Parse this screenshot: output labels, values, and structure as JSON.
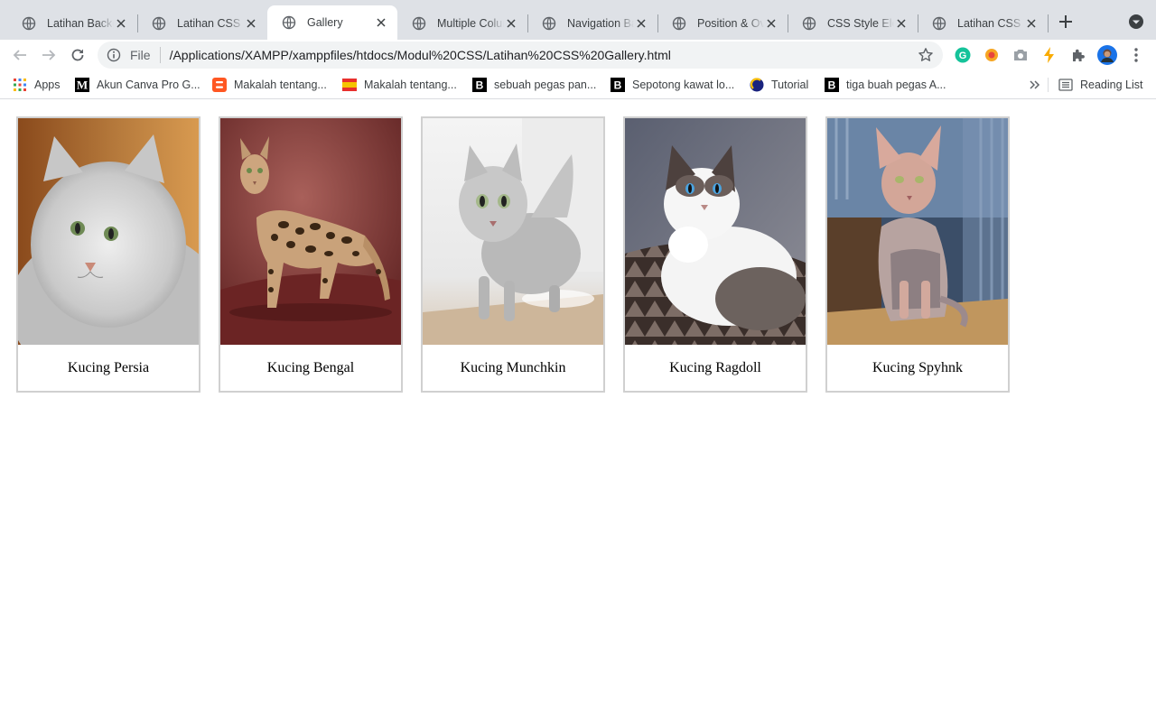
{
  "browser": {
    "tabs": [
      {
        "title": "Latihan Backg",
        "active": false
      },
      {
        "title": "Latihan CSS B",
        "active": false
      },
      {
        "title": "Gallery",
        "active": true
      },
      {
        "title": "Multiple Colum",
        "active": false
      },
      {
        "title": "Navigation Ba",
        "active": false
      },
      {
        "title": "Position & Ov",
        "active": false
      },
      {
        "title": "CSS Style Elem",
        "active": false
      },
      {
        "title": "Latihan CSS T",
        "active": false
      }
    ],
    "address": {
      "scheme_label": "File",
      "url": "/Applications/XAMPP/xamppfiles/htdocs/Modul%20CSS/Latihan%20CSS%20Gallery.html"
    },
    "bookmarks": [
      {
        "label": "Apps",
        "icon": "apps-grid-icon"
      },
      {
        "label": "Akun Canva Pro G...",
        "icon": "medium-m-icon"
      },
      {
        "label": "Makalah tentang...",
        "icon": "blogger-icon"
      },
      {
        "label": "Makalah tentang...",
        "icon": "flag-icon"
      },
      {
        "label": "sebuah pegas pan...",
        "icon": "brainly-b-icon"
      },
      {
        "label": "Sepotong kawat lo...",
        "icon": "brainly-b-icon"
      },
      {
        "label": "Tutorial",
        "icon": "tutorial-logo-icon"
      },
      {
        "label": "tiga buah pegas A...",
        "icon": "brainly-b-icon"
      }
    ],
    "reading_list_label": "Reading List"
  },
  "gallery": {
    "items": [
      {
        "caption": "Kucing Persia",
        "image": "persian-cat-photo"
      },
      {
        "caption": "Kucing Bengal",
        "image": "bengal-cat-photo"
      },
      {
        "caption": "Kucing Munchkin",
        "image": "munchkin-cat-photo"
      },
      {
        "caption": "Kucing Ragdoll",
        "image": "ragdoll-cat-photo"
      },
      {
        "caption": "Kucing Spyhnk",
        "image": "sphynx-cat-photo"
      }
    ]
  },
  "colors": {
    "tabstrip_bg": "#dee1e6",
    "omnibox_bg": "#f1f3f4",
    "card_border": "#d0d0d0",
    "accent_blue": "#1a73e8"
  }
}
